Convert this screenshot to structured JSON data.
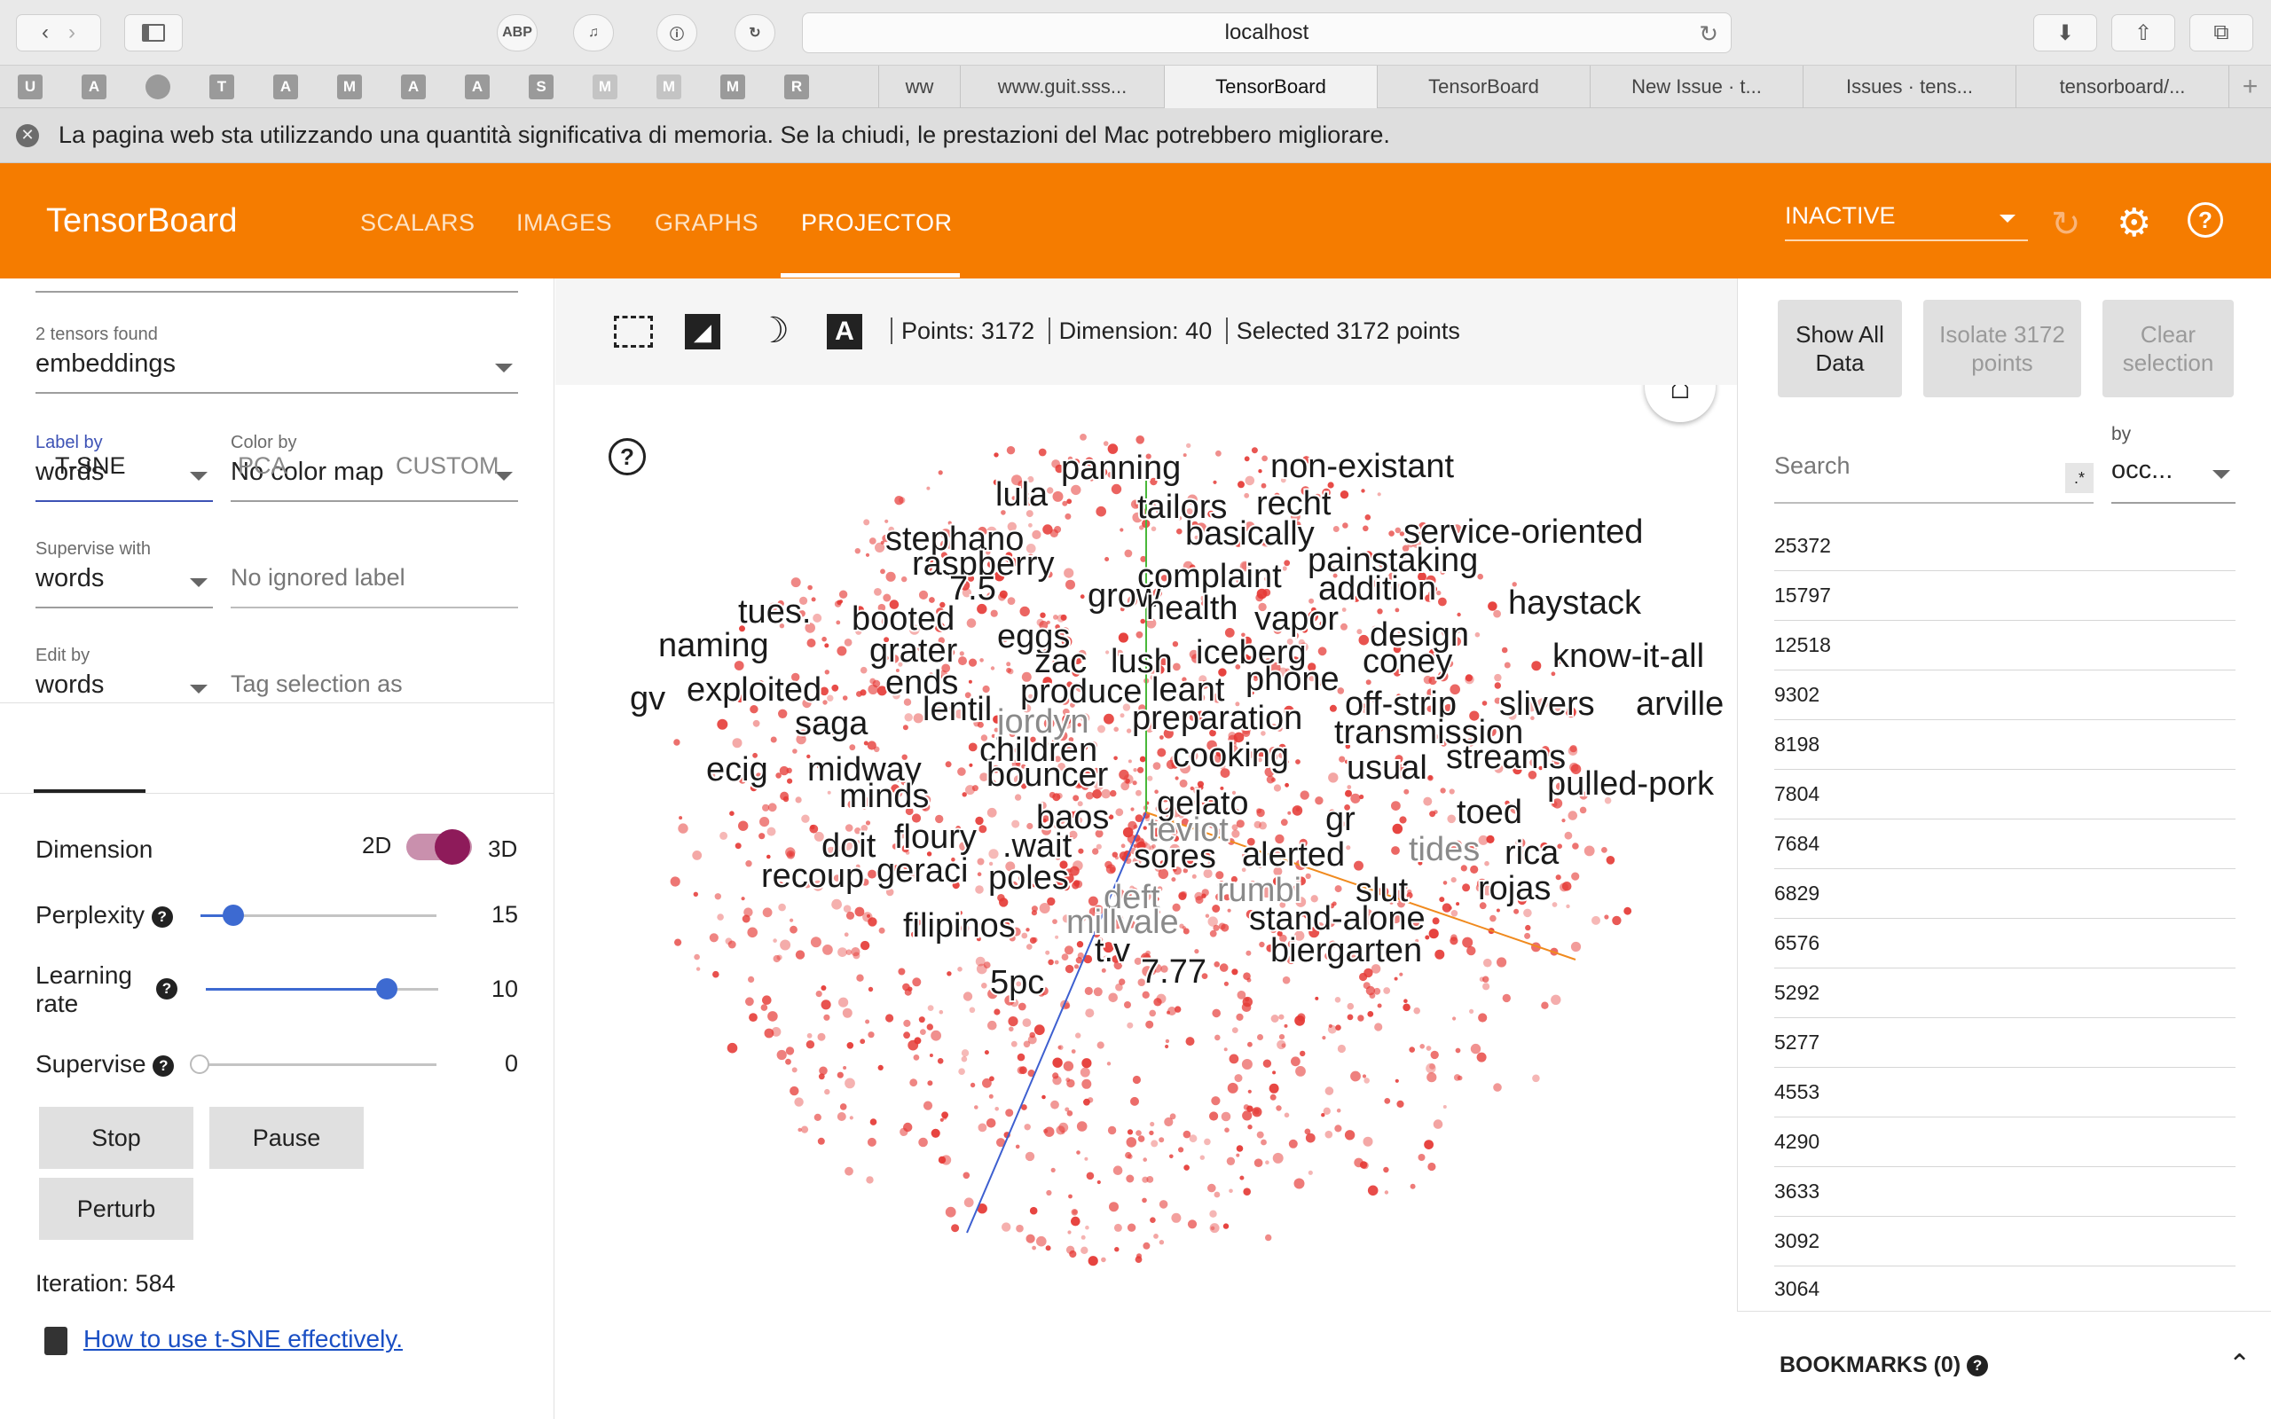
{
  "browser": {
    "url": "localhost",
    "favicons": [
      "U",
      "A",
      "",
      "T",
      "A",
      "M",
      "A",
      "A",
      "S",
      "M",
      "M",
      "M",
      "R"
    ],
    "tabs": [
      {
        "label": "ww",
        "active": false
      },
      {
        "label": "www.guit.sss...",
        "active": false
      },
      {
        "label": "TensorBoard",
        "active": true
      },
      {
        "label": "TensorBoard",
        "active": false
      },
      {
        "label": "New Issue · t...",
        "active": false
      },
      {
        "label": "Issues · tens...",
        "active": false
      },
      {
        "label": "tensorboard/...",
        "active": false
      }
    ],
    "new_tab": "+",
    "memory_warning": "La pagina web sta utilizzando una quantità significativa di memoria. Se la chiudi, le prestazioni del Mac potrebbero migliorare."
  },
  "header": {
    "title": "TensorBoard",
    "nav": [
      "SCALARS",
      "IMAGES",
      "GRAPHS",
      "PROJECTOR"
    ],
    "selected_nav": "PROJECTOR",
    "run_status": "INACTIVE"
  },
  "left": {
    "tensors_found": "2 tensors found",
    "tensor": "embeddings",
    "label_by_label": "Label by",
    "label_by": "words",
    "color_by_label": "Color by",
    "color_by": "No color map",
    "supervise_with_label": "Supervise with",
    "supervise_with": "words",
    "ignored_label_placeholder": "No ignored label",
    "edit_by_label": "Edit by",
    "edit_by": "words",
    "tag_placeholder": "Tag selection as",
    "methods": [
      "T-SNE",
      "PCA",
      "CUSTOM"
    ],
    "dimension_label": "Dimension",
    "dim_2d": "2D",
    "dim_3d": "3D",
    "perplexity_label": "Perplexity",
    "perplexity": "15",
    "perplexity_fraction": 0.14,
    "learning_rate_label_1": "Learning",
    "learning_rate_label_2": "rate",
    "learning_rate": "10",
    "learning_rate_fraction": 0.78,
    "supervise_label": "Supervise",
    "supervise": "0",
    "supervise_fraction": 0.0,
    "stop": "Stop",
    "pause": "Pause",
    "perturb": "Perturb",
    "iteration": "Iteration: 584",
    "help_link": "How to use t-SNE effectively."
  },
  "center": {
    "points": "Points: 3172",
    "dimension": "Dimension: 40",
    "selected": "Selected 3172 points",
    "labels": [
      {
        "t": "panning",
        "dim": false
      },
      {
        "t": "non-existant",
        "dim": false
      },
      {
        "t": "lula",
        "dim": false
      },
      {
        "t": "tailors",
        "dim": false
      },
      {
        "t": "recht",
        "dim": false
      },
      {
        "t": "basically",
        "dim": false
      },
      {
        "t": "service-oriented",
        "dim": false
      },
      {
        "t": "stephano",
        "dim": false
      },
      {
        "t": "painstaking",
        "dim": false
      },
      {
        "t": "raspberry",
        "dim": false
      },
      {
        "t": "complaint",
        "dim": false
      },
      {
        "t": "7.5",
        "dim": false
      },
      {
        "t": "addition",
        "dim": false
      },
      {
        "t": "grow",
        "dim": false
      },
      {
        "t": "health",
        "dim": false
      },
      {
        "t": "haystack",
        "dim": false
      },
      {
        "t": "tues.",
        "dim": false
      },
      {
        "t": "booted",
        "dim": false
      },
      {
        "t": "vapor",
        "dim": false
      },
      {
        "t": "design",
        "dim": false
      },
      {
        "t": "eggs",
        "dim": false
      },
      {
        "t": "naming",
        "dim": false
      },
      {
        "t": "grater",
        "dim": false
      },
      {
        "t": "iceberg",
        "dim": false
      },
      {
        "t": "know-it-all",
        "dim": false
      },
      {
        "t": "zac",
        "dim": false
      },
      {
        "t": "lush",
        "dim": false
      },
      {
        "t": "coney",
        "dim": false
      },
      {
        "t": "ends",
        "dim": false
      },
      {
        "t": "phone",
        "dim": false
      },
      {
        "t": "exploited",
        "dim": false
      },
      {
        "t": "produce",
        "dim": false
      },
      {
        "t": "leant",
        "dim": false
      },
      {
        "t": "gv",
        "dim": false
      },
      {
        "t": "off-strip",
        "dim": false
      },
      {
        "t": "slivers",
        "dim": false
      },
      {
        "t": "arville",
        "dim": false
      },
      {
        "t": "lentil",
        "dim": false
      },
      {
        "t": "jordyn",
        "dim": true
      },
      {
        "t": "preparation",
        "dim": false
      },
      {
        "t": "saga",
        "dim": false
      },
      {
        "t": "transmission",
        "dim": false
      },
      {
        "t": "children",
        "dim": false
      },
      {
        "t": "cooking",
        "dim": false
      },
      {
        "t": "streams",
        "dim": false
      },
      {
        "t": "ecig",
        "dim": false
      },
      {
        "t": "midway",
        "dim": false
      },
      {
        "t": "usual",
        "dim": false
      },
      {
        "t": "bouncer",
        "dim": false
      },
      {
        "t": "pulled-pork",
        "dim": false
      },
      {
        "t": "minds",
        "dim": false
      },
      {
        "t": "gelato",
        "dim": false
      },
      {
        "t": "toed",
        "dim": false
      },
      {
        "t": "baos",
        "dim": false
      },
      {
        "t": "gr",
        "dim": false
      },
      {
        "t": "teviot",
        "dim": true
      },
      {
        "t": "floury",
        "dim": false
      },
      {
        "t": "doit",
        "dim": false
      },
      {
        "t": ".wait",
        "dim": false
      },
      {
        "t": "tides",
        "dim": true
      },
      {
        "t": "alerted",
        "dim": false
      },
      {
        "t": "rica",
        "dim": false
      },
      {
        "t": "sores",
        "dim": false
      },
      {
        "t": "recoup",
        "dim": false
      },
      {
        "t": "geraci",
        "dim": false
      },
      {
        "t": "poles",
        "dim": false
      },
      {
        "t": "rumbi",
        "dim": true
      },
      {
        "t": "slut",
        "dim": false
      },
      {
        "t": "rojas",
        "dim": false
      },
      {
        "t": "deft",
        "dim": true
      },
      {
        "t": "filipinos",
        "dim": false
      },
      {
        "t": "millvale",
        "dim": true
      },
      {
        "t": "stand-alone",
        "dim": false
      },
      {
        "t": "biergarten",
        "dim": false
      },
      {
        "t": "t.v",
        "dim": false
      },
      {
        "t": "7.77",
        "dim": false
      },
      {
        "t": "5pc",
        "dim": false
      }
    ]
  },
  "right": {
    "show_all": "Show All Data",
    "isolate": "Isolate 3172 points",
    "clear": "Clear selection",
    "by_label": "by",
    "search_placeholder": "Search",
    "regex": ".*",
    "by_value": "occ...",
    "list": [
      "25372",
      "15797",
      "12518",
      "9302",
      "8198",
      "7804",
      "7684",
      "6829",
      "6576",
      "5292",
      "5277",
      "4553",
      "4290",
      "3633",
      "3092",
      "3064"
    ],
    "bookmarks": "BOOKMARKS (0)"
  },
  "colors": {
    "accent": "#f57c00",
    "point": "#e53935",
    "slider": "#3d6ad1",
    "toggle": "#8e1b5a"
  }
}
